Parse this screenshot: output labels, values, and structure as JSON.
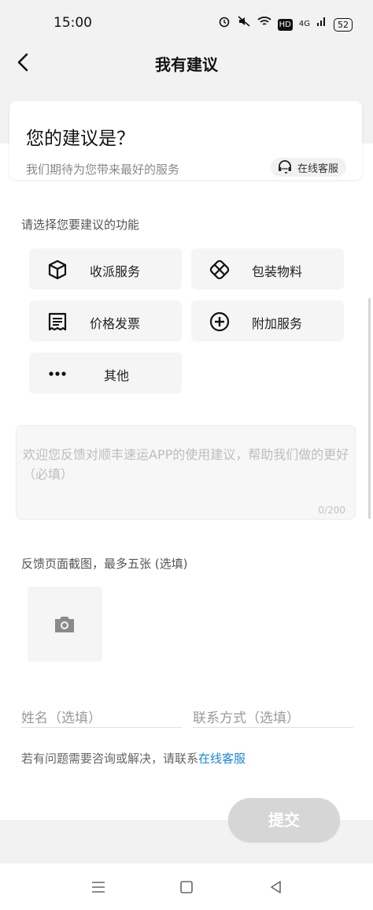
{
  "status_bar": {
    "time": "15:00",
    "network": "4G",
    "hd": "HD",
    "battery": "52"
  },
  "header": {
    "back_icon": "chevron-left-icon",
    "title": "我有建议"
  },
  "intro": {
    "title": "您的建议是？",
    "subtitle": "我们期待为您带来最好的服务",
    "cs_button": "在线客服"
  },
  "function_section": {
    "label": "请选择您要建议的功能",
    "options": [
      {
        "label": "收派服务",
        "icon": "cube-icon"
      },
      {
        "label": "包装物料",
        "icon": "packaging-icon"
      },
      {
        "label": "价格发票",
        "icon": "receipt-icon"
      },
      {
        "label": "附加服务",
        "icon": "plus-circle-icon"
      },
      {
        "label": "其他",
        "icon": "more-dots-icon"
      }
    ]
  },
  "feedback": {
    "placeholder": "欢迎您反馈对顺丰速运APP的使用建议，帮助我们做的更好（必填）",
    "counter": "0/200"
  },
  "screenshots": {
    "label": "反馈页面截图，最多五张 (选填)",
    "upload_icon": "camera-icon"
  },
  "contact": {
    "name_placeholder": "姓名（选填）",
    "contact_placeholder": "联系方式（选填）",
    "note_prefix": "若有问题需要咨询或解决，请联系",
    "note_link": "在线客服"
  },
  "submit": {
    "label": "提交"
  },
  "colors": {
    "link": "#1a86d8",
    "submit_disabled": "#d6d6d6",
    "background_grey": "#f2f2f2"
  }
}
